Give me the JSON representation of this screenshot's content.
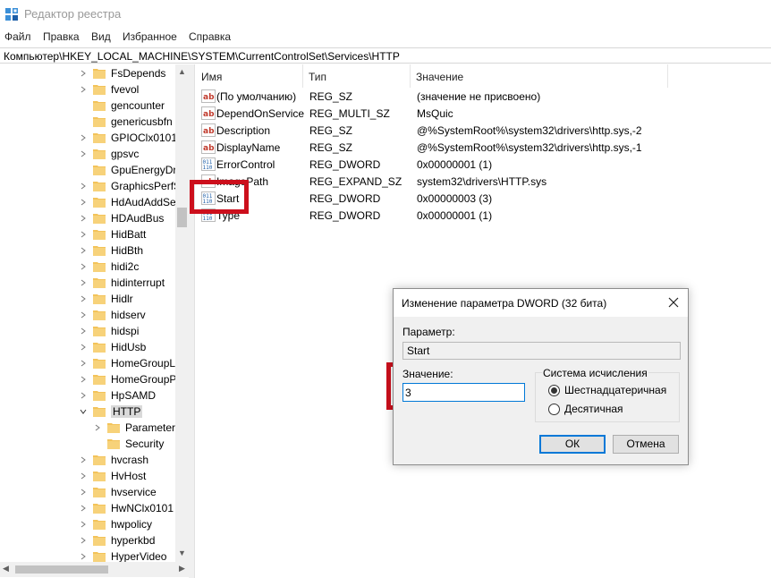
{
  "window": {
    "title": "Редактор реестра",
    "icon": "registry-editor-icon"
  },
  "menu": [
    "Файл",
    "Правка",
    "Вид",
    "Избранное",
    "Справка"
  ],
  "address": "Компьютер\\HKEY_LOCAL_MACHINE\\SYSTEM\\CurrentControlSet\\Services\\HTTP",
  "tree": [
    {
      "label": "FsDepends",
      "level": 0,
      "expander": "collapsed"
    },
    {
      "label": "fvevol",
      "level": 0,
      "expander": "collapsed"
    },
    {
      "label": "gencounter",
      "level": 0,
      "expander": "none"
    },
    {
      "label": "genericusbfn",
      "level": 0,
      "expander": "none"
    },
    {
      "label": "GPIOClx0101",
      "level": 0,
      "expander": "collapsed"
    },
    {
      "label": "gpsvc",
      "level": 0,
      "expander": "collapsed"
    },
    {
      "label": "GpuEnergyDrv",
      "level": 0,
      "expander": "none"
    },
    {
      "label": "GraphicsPerfSv",
      "level": 0,
      "expander": "collapsed"
    },
    {
      "label": "HdAudAddSer",
      "level": 0,
      "expander": "collapsed"
    },
    {
      "label": "HDAudBus",
      "level": 0,
      "expander": "collapsed"
    },
    {
      "label": "HidBatt",
      "level": 0,
      "expander": "collapsed"
    },
    {
      "label": "HidBth",
      "level": 0,
      "expander": "collapsed"
    },
    {
      "label": "hidi2c",
      "level": 0,
      "expander": "collapsed"
    },
    {
      "label": "hidinterrupt",
      "level": 0,
      "expander": "collapsed"
    },
    {
      "label": "Hidlr",
      "level": 0,
      "expander": "collapsed"
    },
    {
      "label": "hidserv",
      "level": 0,
      "expander": "collapsed"
    },
    {
      "label": "hidspi",
      "level": 0,
      "expander": "collapsed"
    },
    {
      "label": "HidUsb",
      "level": 0,
      "expander": "collapsed"
    },
    {
      "label": "HomeGroupLi",
      "level": 0,
      "expander": "collapsed"
    },
    {
      "label": "HomeGroupPr",
      "level": 0,
      "expander": "collapsed"
    },
    {
      "label": "HpSAMD",
      "level": 0,
      "expander": "collapsed"
    },
    {
      "label": "HTTP",
      "level": 0,
      "expander": "expanded",
      "selected": true
    },
    {
      "label": "Parameters",
      "level": 1,
      "expander": "collapsed"
    },
    {
      "label": "Security",
      "level": 1,
      "expander": "none"
    },
    {
      "label": "hvcrash",
      "level": 0,
      "expander": "collapsed"
    },
    {
      "label": "HvHost",
      "level": 0,
      "expander": "collapsed"
    },
    {
      "label": "hvservice",
      "level": 0,
      "expander": "collapsed"
    },
    {
      "label": "HwNClx0101",
      "level": 0,
      "expander": "collapsed"
    },
    {
      "label": "hwpolicy",
      "level": 0,
      "expander": "collapsed"
    },
    {
      "label": "hyperkbd",
      "level": 0,
      "expander": "collapsed"
    },
    {
      "label": "HyperVideo",
      "level": 0,
      "expander": "collapsed"
    }
  ],
  "columns": {
    "name": "Имя",
    "type": "Тип",
    "data": "Значение"
  },
  "values": [
    {
      "name": "(По умолчанию)",
      "type": "REG_SZ",
      "data": "(значение не присвоено)",
      "icon": "ab"
    },
    {
      "name": "DependOnService",
      "type": "REG_MULTI_SZ",
      "data": "MsQuic",
      "icon": "ab"
    },
    {
      "name": "Description",
      "type": "REG_SZ",
      "data": "@%SystemRoot%\\system32\\drivers\\http.sys,-2",
      "icon": "ab"
    },
    {
      "name": "DisplayName",
      "type": "REG_SZ",
      "data": "@%SystemRoot%\\system32\\drivers\\http.sys,-1",
      "icon": "ab"
    },
    {
      "name": "ErrorControl",
      "type": "REG_DWORD",
      "data": "0x00000001 (1)",
      "icon": "bin"
    },
    {
      "name": "ImagePath",
      "type": "REG_EXPAND_SZ",
      "data": "system32\\drivers\\HTTP.sys",
      "icon": "ab"
    },
    {
      "name": "Start",
      "type": "REG_DWORD",
      "data": "0x00000003 (3)",
      "icon": "bin"
    },
    {
      "name": "Type",
      "type": "REG_DWORD",
      "data": "0x00000001 (1)",
      "icon": "bin"
    }
  ],
  "dialog": {
    "title": "Изменение параметра DWORD (32 бита)",
    "param_label": "Параметр:",
    "param_value": "Start",
    "value_label": "Значение:",
    "value": "3",
    "radix_label": "Система исчисления",
    "radix_options": [
      "Шестнадцатеричная",
      "Десятичная"
    ],
    "radix_selected": "Шестнадцатеричная",
    "ok": "ОК",
    "cancel": "Отмена"
  },
  "colors": {
    "highlight": "#cc0f1c",
    "folder": "#f3c35a",
    "accent": "#0078d7"
  }
}
